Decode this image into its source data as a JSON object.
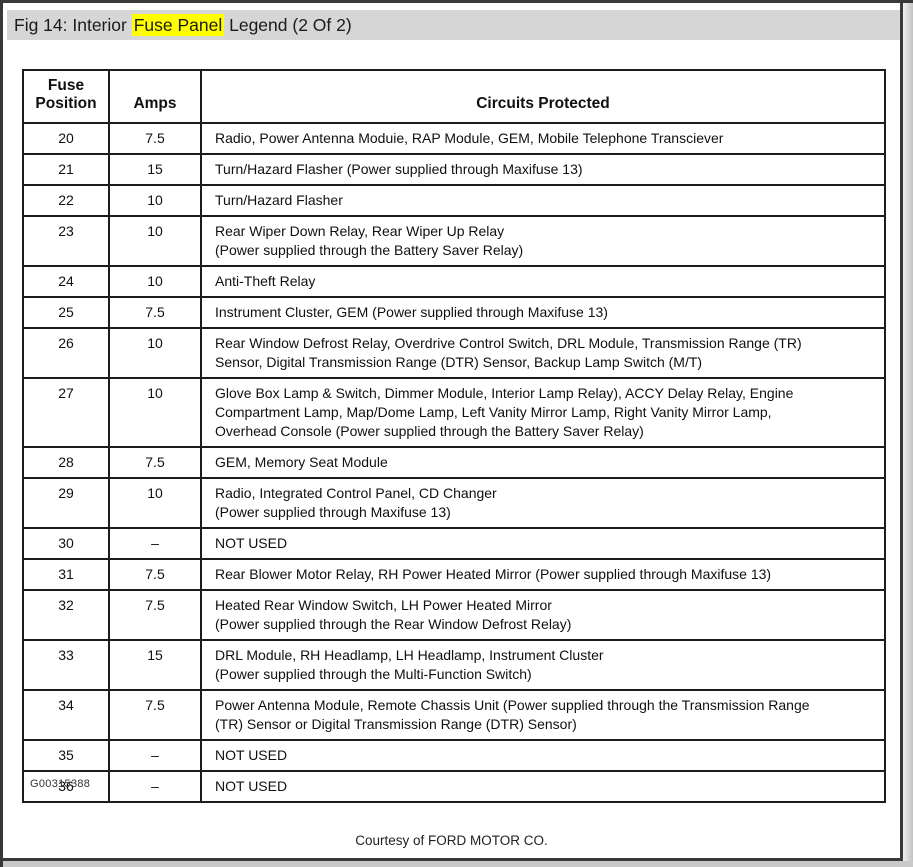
{
  "window": {
    "title_prefix": "Fig 14: Interior",
    "title_highlight": "Fuse Panel",
    "title_suffix": "Legend (2 Of 2)",
    "highlight_color": "#ffff00",
    "titlebar_bg": "#d6d6d6"
  },
  "table": {
    "headers": [
      "Fuse Position",
      "Amps",
      "Circuits Protected"
    ],
    "rows": [
      {
        "position": "20",
        "amps": "7.5",
        "circuits": [
          "Radio, Power Antenna Moduie, RAP Module, GEM, Mobile Telephone Transciever"
        ]
      },
      {
        "position": "21",
        "amps": "15",
        "circuits": [
          "Turn/Hazard Flasher (Power supplied through Maxifuse 13)"
        ]
      },
      {
        "position": "22",
        "amps": "10",
        "circuits": [
          "Turn/Hazard Flasher"
        ]
      },
      {
        "position": "23",
        "amps": "10",
        "circuits": [
          "Rear Wiper Down Relay, Rear Wiper Up Relay",
          "(Power supplied through the Battery Saver Relay)"
        ]
      },
      {
        "position": "24",
        "amps": "10",
        "circuits": [
          "Anti-Theft Relay"
        ]
      },
      {
        "position": "25",
        "amps": "7.5",
        "circuits": [
          "Instrument Cluster, GEM (Power supplied through Maxifuse 13)"
        ]
      },
      {
        "position": "26",
        "amps": "10",
        "circuits": [
          "Rear Window Defrost Relay, Overdrive Control Switch, DRL Module, Transmission Range (TR)",
          "Sensor, Digital Transmission Range (DTR) Sensor, Backup Lamp Switch (M/T)"
        ]
      },
      {
        "position": "27",
        "amps": "10",
        "circuits": [
          "Glove Box Lamp & Switch, Dimmer Module, Interior Lamp Relay), ACCY Delay Relay, Engine",
          "Compartment Lamp, Map/Dome Lamp, Left Vanity Mirror Lamp, Right Vanity Mirror Lamp,",
          "Overhead Console (Power supplied through the Battery Saver Relay)"
        ]
      },
      {
        "position": "28",
        "amps": "7.5",
        "circuits": [
          "GEM, Memory Seat Module"
        ]
      },
      {
        "position": "29",
        "amps": "10",
        "circuits": [
          "Radio, Integrated Control Panel, CD Changer",
          "(Power supplied through Maxifuse 13)"
        ]
      },
      {
        "position": "30",
        "amps": "–",
        "circuits": [
          "NOT USED"
        ]
      },
      {
        "position": "31",
        "amps": "7.5",
        "circuits": [
          "Rear Blower Motor Relay, RH Power Heated Mirror (Power supplied through Maxifuse 13)"
        ]
      },
      {
        "position": "32",
        "amps": "7.5",
        "circuits": [
          "Heated Rear Window Switch, LH Power Heated Mirror",
          "(Power supplied through the Rear Window Defrost Relay)"
        ]
      },
      {
        "position": "33",
        "amps": "15",
        "circuits": [
          "DRL Module, RH Headlamp, LH Headlamp, Instrument Cluster",
          "(Power supplied through the Multi-Function Switch)"
        ]
      },
      {
        "position": "34",
        "amps": "7.5",
        "circuits": [
          "Power Antenna Module, Remote Chassis Unit (Power supplied through the Transmission Range",
          "(TR) Sensor or Digital Transmission Range (DTR) Sensor)"
        ]
      },
      {
        "position": "35",
        "amps": "–",
        "circuits": [
          "NOT USED"
        ]
      },
      {
        "position": "36",
        "amps": "–",
        "circuits": [
          "NOT USED"
        ]
      }
    ]
  },
  "footer": {
    "figure_code": "G00315388",
    "courtesy": "Courtesy of FORD MOTOR CO."
  }
}
